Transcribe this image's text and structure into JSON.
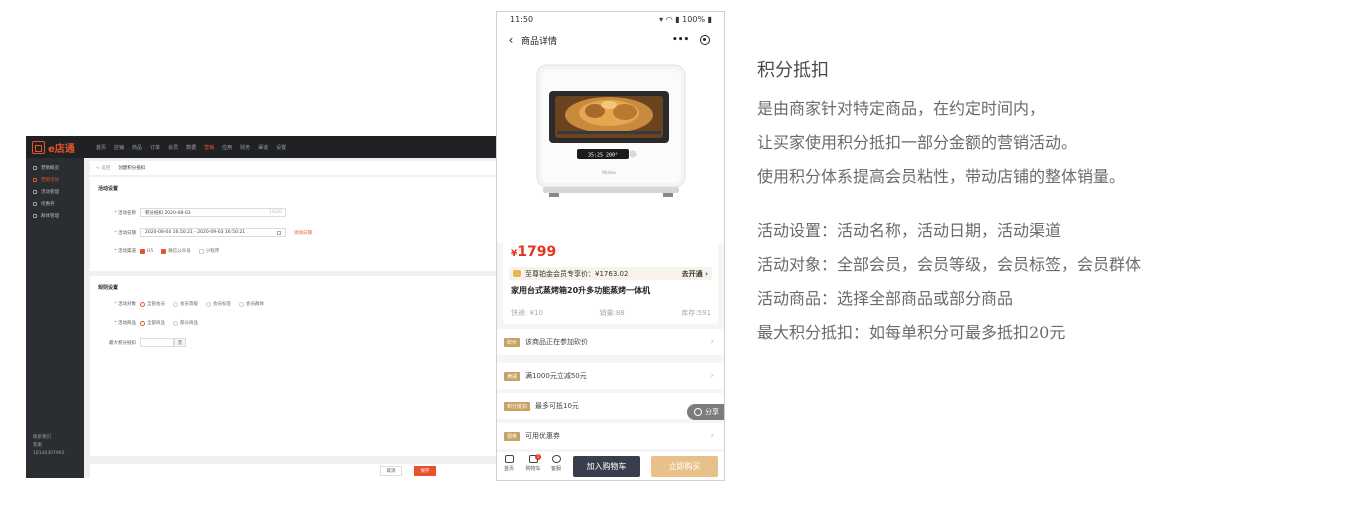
{
  "admin": {
    "logo_text": "e店通",
    "topnav": [
      "首页",
      "店铺",
      "商品",
      "订单",
      "会员",
      "数据",
      "营销",
      "应用",
      "财务",
      "渠道",
      "设置"
    ],
    "topnav_active": "营销",
    "sidebar": [
      "营销概览",
      "营销活动",
      "活动管理",
      "优惠券",
      "群体管理"
    ],
    "sidebar_active": "营销活动",
    "sidebar_footer": [
      "联系我们",
      "客服",
      "18146307965"
    ],
    "breadcrumb": {
      "back": "< 返回",
      "current": "创建积分抵扣"
    },
    "section_activity": "活动设置",
    "section_rules": "规则设置",
    "activity_name": {
      "label": "活动名称",
      "value": "积分抵扣 2020-08-03",
      "count": "10/20"
    },
    "activity_date": {
      "label": "活动日期",
      "value": "2020-08-04 16:50:21 - 2020-09-03 16:50:21",
      "link": "添加日期"
    },
    "activity_channel": {
      "label": "活动渠道",
      "options": [
        "H5",
        "微信公众号",
        "小程序"
      ]
    },
    "activity_target": {
      "label": "活动对象",
      "options": [
        "全部会员",
        "会员等级",
        "会员标签",
        "会员群体"
      ]
    },
    "activity_goods": {
      "label": "活动商品",
      "options": [
        "全部商品",
        "部分商品"
      ]
    },
    "max_points": {
      "label": "最大积分抵扣",
      "unit": "元"
    },
    "buttons": {
      "cancel": "取消",
      "save": "保存"
    }
  },
  "phone": {
    "time": "11:50",
    "battery": "100%",
    "title": "商品详情",
    "price_symbol": "¥",
    "price": "1799",
    "member_label": "至尊铂金会员专享价：¥1763.02",
    "member_action": "去开通",
    "product_name": "家用台式蒸烤箱20升多功能蒸烤一体机",
    "shipping": "快递: ¥10",
    "sales": "销量:88",
    "stock": "库存:591",
    "oven_display": "35:25  200°",
    "oven_brand": "Midea",
    "promos": [
      {
        "tag": "砍价",
        "text": "该商品正在参加砍价"
      },
      {
        "tag": "满减",
        "text": "满1000元立减50元"
      },
      {
        "tag": "积分抵扣",
        "text": "最多可抵10元"
      },
      {
        "tag": "领券",
        "text": "可用优惠券"
      }
    ],
    "share": "分享",
    "tabbar": [
      "首页",
      "购物车",
      "客服"
    ],
    "cart_count": "1",
    "add_cart": "加入购物车",
    "buy_now": "立即购买"
  },
  "description": {
    "heading": "积分抵扣",
    "lines": [
      "是由商家针对特定商品，在约定时间内，",
      "让买家使用积分抵扣一部分金额的营销活动。",
      "使用积分体系提高会员粘性，带动店铺的整体销量。"
    ],
    "details": [
      "活动设置：活动名称，活动日期，活动渠道",
      "活动对象：全部会员，会员等级，会员标签，会员群体",
      "活动商品：选择全部商品或部分商品",
      "最大积分抵扣：如每单积分可最多抵扣20元"
    ]
  },
  "colors": {
    "accent": "#e8532a",
    "price": "#e8321e",
    "gold": "#c9a163",
    "dark_button": "#3a3e4c",
    "buy_button": "#e8c08a"
  }
}
